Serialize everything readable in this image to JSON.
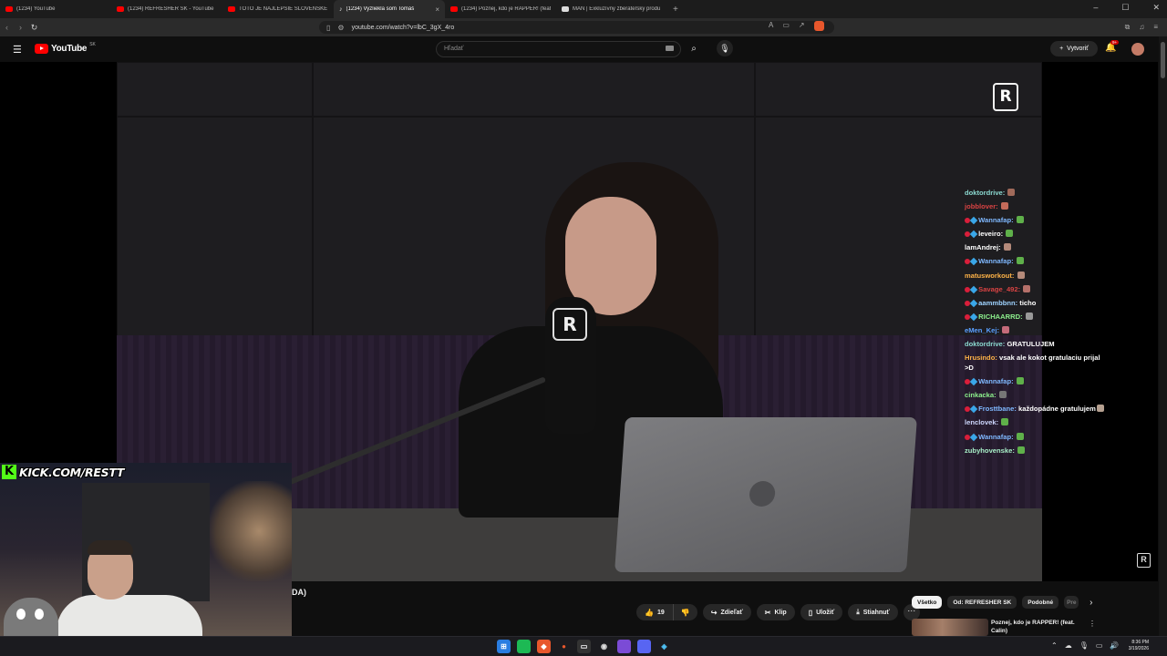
{
  "browser": {
    "tabs": [
      {
        "title": "(1234) YouTube",
        "favicon": "youtube-icon",
        "active": false
      },
      {
        "title": "(1234) REFRESHER SK - YouTube",
        "favicon": "youtube-icon",
        "active": false
      },
      {
        "title": "TOTO JE NAJLEPŠIE SLOVENSKÉ UM",
        "favicon": "youtube-icon",
        "active": false
      },
      {
        "title": "(1234) Vyzliekla som Tomáš",
        "favicon": "youtube-icon",
        "active": true,
        "close": "×"
      },
      {
        "title": "(1234) Poznej, kdo je RAPPER! (feat.",
        "favicon": "youtube-icon",
        "active": false
      },
      {
        "title": "MAN | Exkluzívny zberateľský produ",
        "favicon": "web-icon",
        "active": false
      }
    ],
    "new_tab": "+",
    "window_controls": [
      "–",
      "☐",
      "✕"
    ],
    "url": "youtube.com/watch?v=lbC_3gX_4ro"
  },
  "youtube": {
    "logo_text": "YouTube",
    "country_code": "SK",
    "search_placeholder": "Hľadať",
    "create_label": "Vytvoriť",
    "notification_badge": "9+"
  },
  "video": {
    "channel_logo": "R",
    "title_fragment": "DA)",
    "actions": {
      "like_count": "19",
      "share": "Zdieľať",
      "clip": "Klip",
      "save": "Uložiť",
      "download": "Stiahnuť"
    }
  },
  "stream_overlay": {
    "kick_letter": "K",
    "kick_url": "KICK.COM/RESTT",
    "chat": [
      {
        "user": "doktordrive:",
        "color": "#8bd9d0",
        "badges": false,
        "msg": "",
        "emote": "#a06a5a"
      },
      {
        "user": "jobblover:",
        "color": "#d94343",
        "badges": false,
        "msg": "",
        "emote": "#c46b5a"
      },
      {
        "user": "Wannafap:",
        "color": "#7fb8ff",
        "badges": true,
        "msg": "",
        "emote": "#5fb04a"
      },
      {
        "user": "leveiro:",
        "color": "#ffffff",
        "badges": true,
        "msg": "",
        "emote": "#5fb04a"
      },
      {
        "user": "lamAndrej:",
        "color": "#ffffff",
        "badges": false,
        "msg": "",
        "emote": "#b58a7a"
      },
      {
        "user": "Wannafap:",
        "color": "#7fb8ff",
        "badges": true,
        "msg": "",
        "emote": "#5fb04a"
      },
      {
        "user": "matusworkout:",
        "color": "#ffb347",
        "badges": false,
        "msg": "",
        "emote": "#b58a7a"
      },
      {
        "user": "Savage_492:",
        "color": "#d94343",
        "badges": true,
        "msg": "",
        "emote": "#b5706a"
      },
      {
        "user": "aammbbnn:",
        "color": "#9fd3ff",
        "badges": true,
        "msg": "ticho",
        "emote": ""
      },
      {
        "user": "RICHAARRD:",
        "color": "#8df08d",
        "badges": true,
        "msg": "",
        "emote": "#999999"
      },
      {
        "user": "eMen_Kej:",
        "color": "#5aa0ff",
        "badges": false,
        "msg": "",
        "emote": "#c46b7a"
      },
      {
        "user": "doktordrive:",
        "color": "#8bd9d0",
        "badges": false,
        "msg": "GRATULUJEM",
        "emote": ""
      },
      {
        "user": "Hrusindo:",
        "color": "#ffb347",
        "badges": false,
        "msg": "vsak ale kokot gratulaciu prijal >D",
        "emote": ""
      },
      {
        "user": "Wannafap:",
        "color": "#7fb8ff",
        "badges": true,
        "msg": "",
        "emote": "#5fb04a"
      },
      {
        "user": "cinkacka:",
        "color": "#8df08d",
        "badges": false,
        "msg": "",
        "emote": "#777777"
      },
      {
        "user": "Frosttbane:",
        "color": "#7fb8ff",
        "badges": true,
        "msg": "každopádne gratulujem",
        "emote": "#b5a090"
      },
      {
        "user": "lenclovek:",
        "color": "#cfd8ff",
        "badges": false,
        "msg": "",
        "emote": "#5fb04a"
      },
      {
        "user": "Wannafap:",
        "color": "#7fb8ff",
        "badges": true,
        "msg": "",
        "emote": "#5fb04a"
      },
      {
        "user": "zubyhovenske:",
        "color": "#a8f0c8",
        "badges": false,
        "msg": "",
        "emote": "#5fb04a"
      }
    ]
  },
  "sidebar": {
    "chips": [
      "Všetko",
      "Od: REFRESHER SK",
      "Podobné",
      "Pre"
    ],
    "recommendation": {
      "title": "Poznej, kdo je RAPPER! (feat. Calin)"
    }
  },
  "taskbar": {
    "time": "8:36 PM",
    "date": "3/19/2026"
  },
  "colors": {
    "brand_red": "#ff0000",
    "kick_green": "#53fc18",
    "chip_selected": "#f1f1f1"
  }
}
